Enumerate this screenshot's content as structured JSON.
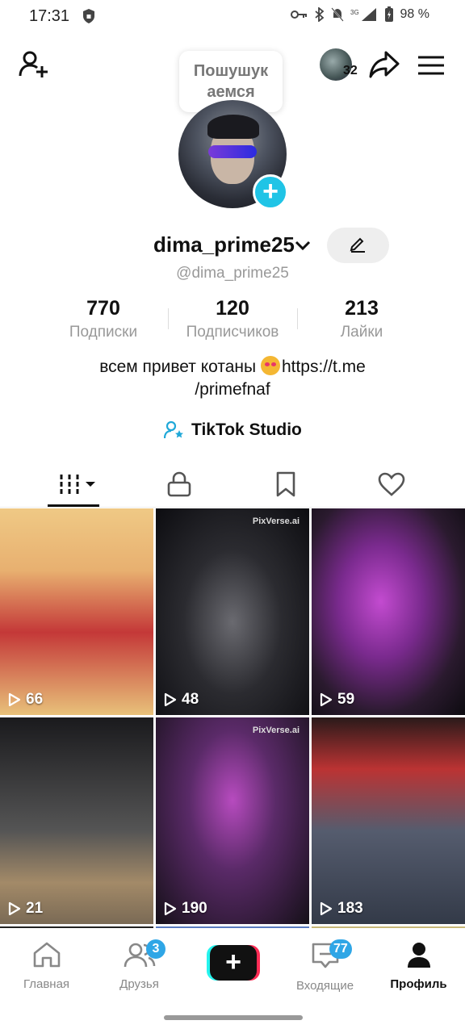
{
  "status": {
    "time": "17:31",
    "battery": "98 %"
  },
  "header": {
    "story_count": "32",
    "tooltip_line1": "Пошушук",
    "tooltip_line2": "аемся"
  },
  "profile": {
    "username": "dima_prime25",
    "handle": "@dima_prime25",
    "stats": [
      {
        "value": "770",
        "label": "Подписки"
      },
      {
        "value": "120",
        "label": "Подписчиков"
      },
      {
        "value": "213",
        "label": "Лайки"
      }
    ],
    "bio_line1_pre": "всем привет котаны ",
    "bio_line1_post": "https://t.me",
    "bio_line2": "/primefnaf",
    "studio_label": "TikTok Studio"
  },
  "videos": [
    {
      "views": "66",
      "watermark": ""
    },
    {
      "views": "48",
      "watermark": "PixVerse.ai"
    },
    {
      "views": "59",
      "watermark": ""
    },
    {
      "views": "21",
      "watermark": ""
    },
    {
      "views": "190",
      "watermark": "PixVerse.ai"
    },
    {
      "views": "183",
      "watermark": ""
    }
  ],
  "nav": {
    "home": "Главная",
    "friends": "Друзья",
    "friends_badge": "3",
    "create": "+",
    "inbox": "Входящие",
    "inbox_badge": "77",
    "profile": "Профиль"
  },
  "colors": {
    "accent": "#20c4e6",
    "badge": "#2fa6e6",
    "tiktok_cyan": "#25f4ee",
    "tiktok_red": "#fe2c55"
  }
}
